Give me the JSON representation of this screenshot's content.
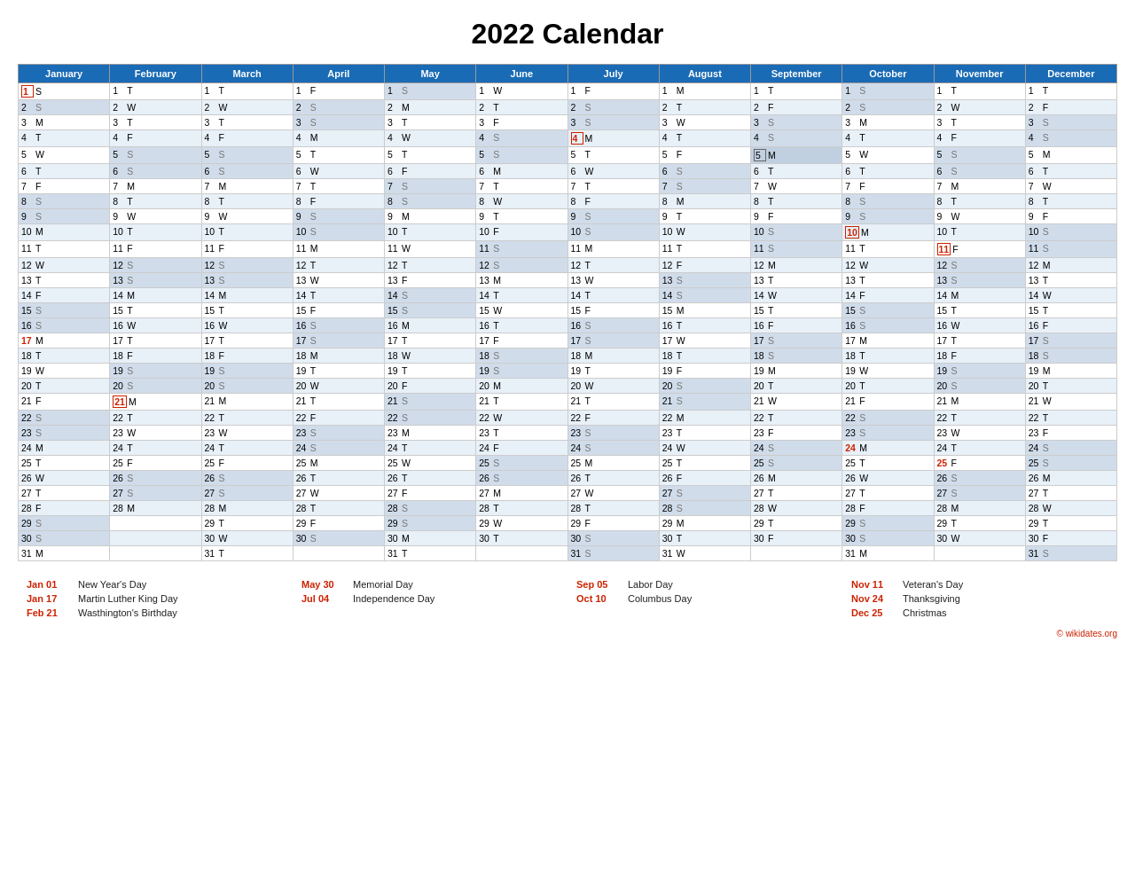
{
  "title": "2022 Calendar",
  "months": [
    "January",
    "February",
    "March",
    "April",
    "May",
    "June",
    "July",
    "August",
    "September",
    "October",
    "November",
    "December"
  ],
  "rows": [
    [
      "1 S",
      "1 T",
      "1 T",
      "1 F",
      "1 S",
      "1 W",
      "1 F",
      "1 M",
      "1 T",
      "1 S",
      "1 T",
      "1 T"
    ],
    [
      "2 S",
      "2 W",
      "2 W",
      "2 S",
      "2 M",
      "2 T",
      "2 S",
      "2 T",
      "2 F",
      "2 S",
      "2 W",
      "2 F"
    ],
    [
      "3 M",
      "3 T",
      "3 T",
      "3 S",
      "3 T",
      "3 F",
      "3 S",
      "3 W",
      "3 S",
      "3 M",
      "3 T",
      "3 S"
    ],
    [
      "4 T",
      "4 F",
      "4 F",
      "4 M",
      "4 W",
      "4 S",
      "4 M",
      "4 T",
      "4 S",
      "4 T",
      "4 F",
      "4 S"
    ],
    [
      "5 W",
      "5 S",
      "5 S",
      "5 T",
      "5 T",
      "5 S",
      "5 T",
      "5 F",
      "5 M",
      "5 W",
      "5 S",
      "5 M"
    ],
    [
      "6 T",
      "6 S",
      "6 S",
      "6 W",
      "6 F",
      "6 M",
      "6 W",
      "6 S",
      "6 T",
      "6 T",
      "6 S",
      "6 T"
    ],
    [
      "7 F",
      "7 M",
      "7 M",
      "7 T",
      "7 S",
      "7 T",
      "7 T",
      "7 S",
      "7 W",
      "7 F",
      "7 M",
      "7 W"
    ],
    [
      "8 S",
      "8 T",
      "8 T",
      "8 F",
      "8 S",
      "8 W",
      "8 F",
      "8 M",
      "8 T",
      "8 S",
      "8 T",
      "8 T"
    ],
    [
      "9 S",
      "9 W",
      "9 W",
      "9 S",
      "9 M",
      "9 T",
      "9 S",
      "9 T",
      "9 F",
      "9 S",
      "9 W",
      "9 F"
    ],
    [
      "10 M",
      "10 T",
      "10 T",
      "10 S",
      "10 T",
      "10 F",
      "10 S",
      "10 W",
      "10 S",
      "10 M",
      "10 T",
      "10 S"
    ],
    [
      "11 T",
      "11 F",
      "11 F",
      "11 M",
      "11 W",
      "11 S",
      "11 M",
      "11 T",
      "11 S",
      "11 T",
      "11 F",
      "11 S"
    ],
    [
      "12 W",
      "12 S",
      "12 S",
      "12 T",
      "12 T",
      "12 S",
      "12 T",
      "12 F",
      "12 M",
      "12 W",
      "12 S",
      "12 M"
    ],
    [
      "13 T",
      "13 S",
      "13 S",
      "13 W",
      "13 F",
      "13 M",
      "13 W",
      "13 S",
      "13 T",
      "13 T",
      "13 S",
      "13 T"
    ],
    [
      "14 F",
      "14 M",
      "14 M",
      "14 T",
      "14 S",
      "14 T",
      "14 T",
      "14 S",
      "14 W",
      "14 F",
      "14 M",
      "14 W"
    ],
    [
      "15 S",
      "15 T",
      "15 T",
      "15 F",
      "15 S",
      "15 W",
      "15 F",
      "15 M",
      "15 T",
      "15 S",
      "15 T",
      "15 T"
    ],
    [
      "16 S",
      "16 W",
      "16 W",
      "16 S",
      "16 M",
      "16 T",
      "16 S",
      "16 T",
      "16 F",
      "16 S",
      "16 W",
      "16 F"
    ],
    [
      "17 M",
      "17 T",
      "17 T",
      "17 S",
      "17 T",
      "17 F",
      "17 S",
      "17 W",
      "17 S",
      "17 M",
      "17 T",
      "17 S"
    ],
    [
      "18 T",
      "18 F",
      "18 F",
      "18 M",
      "18 W",
      "18 S",
      "18 M",
      "18 T",
      "18 S",
      "18 T",
      "18 F",
      "18 S"
    ],
    [
      "19 W",
      "19 S",
      "19 S",
      "19 T",
      "19 T",
      "19 S",
      "19 T",
      "19 F",
      "19 M",
      "19 W",
      "19 S",
      "19 M"
    ],
    [
      "20 T",
      "20 S",
      "20 S",
      "20 W",
      "20 F",
      "20 M",
      "20 W",
      "20 S",
      "20 T",
      "20 T",
      "20 S",
      "20 T"
    ],
    [
      "21 F",
      "21 M",
      "21 M",
      "21 T",
      "21 S",
      "21 T",
      "21 T",
      "21 S",
      "21 W",
      "21 F",
      "21 M",
      "21 W"
    ],
    [
      "22 S",
      "22 T",
      "22 T",
      "22 F",
      "22 S",
      "22 W",
      "22 F",
      "22 M",
      "22 T",
      "22 S",
      "22 T",
      "22 T"
    ],
    [
      "23 S",
      "23 W",
      "23 W",
      "23 S",
      "23 M",
      "23 T",
      "23 S",
      "23 T",
      "23 F",
      "23 S",
      "23 W",
      "23 F"
    ],
    [
      "24 M",
      "24 T",
      "24 T",
      "24 S",
      "24 T",
      "24 F",
      "24 S",
      "24 W",
      "24 S",
      "24 M",
      "24 T",
      "24 S"
    ],
    [
      "25 T",
      "25 F",
      "25 F",
      "25 M",
      "25 W",
      "25 S",
      "25 M",
      "25 T",
      "25 S",
      "25 T",
      "25 F",
      "25 S"
    ],
    [
      "26 W",
      "26 S",
      "26 S",
      "26 T",
      "26 T",
      "26 S",
      "26 T",
      "26 F",
      "26 M",
      "26 W",
      "26 S",
      "26 M"
    ],
    [
      "27 T",
      "27 S",
      "27 S",
      "27 W",
      "27 F",
      "27 M",
      "27 W",
      "27 S",
      "27 T",
      "27 T",
      "27 S",
      "27 T"
    ],
    [
      "28 F",
      "28 M",
      "28 M",
      "28 T",
      "28 S",
      "28 T",
      "28 T",
      "28 S",
      "28 W",
      "28 F",
      "28 M",
      "28 W"
    ],
    [
      "29 S",
      "",
      "29 T",
      "29 F",
      "29 S",
      "29 W",
      "29 F",
      "29 M",
      "29 T",
      "29 S",
      "29 T",
      "29 T"
    ],
    [
      "30 S",
      "",
      "30 W",
      "30 S",
      "30 M",
      "30 T",
      "30 S",
      "30 T",
      "30 F",
      "30 S",
      "30 W",
      "30 F"
    ],
    [
      "31 M",
      "",
      "31 T",
      "",
      "31 T",
      "",
      "31 S",
      "31 W",
      "",
      "31 M",
      "",
      "31 S"
    ]
  ],
  "special": {
    "red_boxed": [
      {
        "row": 0,
        "col": 0
      },
      {
        "row": 16,
        "col": 0
      },
      {
        "row": 20,
        "col": 1
      },
      {
        "row": 3,
        "col": 6
      },
      {
        "row": 4,
        "col": 8
      },
      {
        "row": 9,
        "col": 9
      },
      {
        "row": 10,
        "col": 10
      },
      {
        "row": 23,
        "col": 9
      },
      {
        "row": 24,
        "col": 10
      }
    ]
  },
  "holidays": [
    {
      "date": "Jan 01",
      "name": "New Year's Day"
    },
    {
      "date": "Jan 17",
      "name": "Martin Luther King Day"
    },
    {
      "date": "Feb 21",
      "name": "Wasthington's Birthday"
    },
    {
      "date": "May 30",
      "name": "Memorial Day"
    },
    {
      "date": "Jul 04",
      "name": "Independence Day"
    },
    {
      "date": "Sep 05",
      "name": "Labor Day"
    },
    {
      "date": "Oct 10",
      "name": "Columbus Day"
    },
    {
      "date": "Nov 11",
      "name": "Veteran's Day"
    },
    {
      "date": "Nov 24",
      "name": "Thanksgiving"
    },
    {
      "date": "Dec 25",
      "name": "Christmas"
    }
  ],
  "wikidates": "© wikidates.org"
}
